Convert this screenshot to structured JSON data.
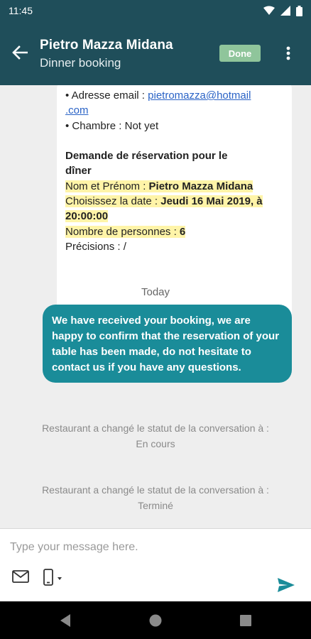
{
  "status_bar": {
    "time": "11:45"
  },
  "header": {
    "title": "Pietro Mazza Midana",
    "subtitle": "Dinner booking",
    "status_badge": "Done"
  },
  "card": {
    "email_label": "• Adresse email : ",
    "email_value_1": "pietromazza@hotmail",
    "email_value_2": ".com",
    "room_line": "• Chambre : Not yet",
    "section_title_1": "Demande de réservation pour le",
    "section_title_2": "dîner",
    "name_label": "Nom et Prénom : ",
    "name_value": "Pietro Mazza Midana",
    "date_label": "Choisissez la date : ",
    "date_value_1": "Jeudi 16 Mai 2019, à",
    "date_value_2": "20:00:00",
    "persons_label": "Nombre de personnes : ",
    "persons_value": "6",
    "precisions": "Précisions : /"
  },
  "date_separator": "Today",
  "outgoing_message": "We have received your booking, we are happy to confirm that the reservation of your table has been made, do not hesitate to contact us if you have any questions.",
  "system_messages": [
    {
      "line1": "Restaurant a changé le statut de la conversation à :",
      "line2": "En cours"
    },
    {
      "line1": "Restaurant a changé le statut de la conversation à :",
      "line2": "Terminé"
    }
  ],
  "composer": {
    "placeholder": "Type your message here."
  },
  "icons": {
    "back": "arrow-left-icon",
    "overflow": "more-vertical-icon",
    "mail": "mail-icon",
    "phone": "mobile-phone-icon",
    "send": "send-icon"
  },
  "colors": {
    "header": "#1f4e5a",
    "accent": "#1a8c99",
    "done": "#8fc59b",
    "highlight": "#fff4a8"
  }
}
